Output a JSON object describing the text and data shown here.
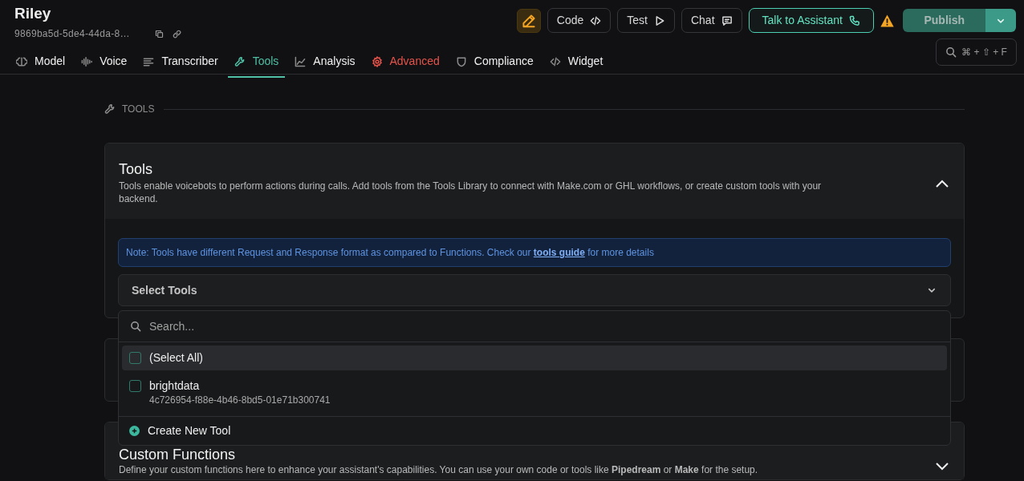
{
  "assistant": {
    "name": "Riley",
    "id": "9869ba5d-5de4-44da-8…"
  },
  "header_buttons": [
    {
      "label": "Code"
    },
    {
      "label": "Test"
    },
    {
      "label": "Chat"
    }
  ],
  "talk_button": {
    "label": "Talk to Assistant"
  },
  "publish_button": {
    "label": "Publish"
  },
  "search_shortcut": {
    "keys": "⌘ + ⇧ + F"
  },
  "tabs": [
    {
      "label": "Model",
      "selected": false,
      "alert": false
    },
    {
      "label": "Voice",
      "selected": false,
      "alert": false
    },
    {
      "label": "Transcriber",
      "selected": false,
      "alert": false
    },
    {
      "label": "Tools",
      "selected": true,
      "alert": false
    },
    {
      "label": "Analysis",
      "selected": false,
      "alert": false
    },
    {
      "label": "Advanced",
      "selected": false,
      "alert": true
    },
    {
      "label": "Compliance",
      "selected": false,
      "alert": false
    },
    {
      "label": "Widget",
      "selected": false,
      "alert": false
    }
  ],
  "section_label": "TOOLS",
  "tools_card": {
    "title": "Tools",
    "description": "Tools enable voicebots to perform actions during calls. Add tools from the Tools Library to connect with Make.com or GHL workflows, or create custom tools with your backend.",
    "expanded": true,
    "note": {
      "before": "Note: Tools have different Request and Response format as compared to Functions. Check our",
      "link": "tools guide",
      "after": "for more details"
    },
    "select": {
      "label": "Select Tools"
    }
  },
  "dropdown": {
    "search_placeholder": "Search...",
    "options": [
      {
        "label": "(Select All)",
        "checked": false,
        "selected": true
      },
      {
        "label": "brightdata",
        "sublabel": "4c726954-f88e-4b46-8bd5-01e71b300741",
        "checked": false,
        "selected": false
      }
    ],
    "create_label": "Create New Tool"
  },
  "functions_card": {
    "title": "Custom Functions",
    "description": "Define your custom functions here to enhance your assistant's capabilities. You can use your own code or tools like **Pipedream** or **Make** for the setup.",
    "expanded": false
  }
}
